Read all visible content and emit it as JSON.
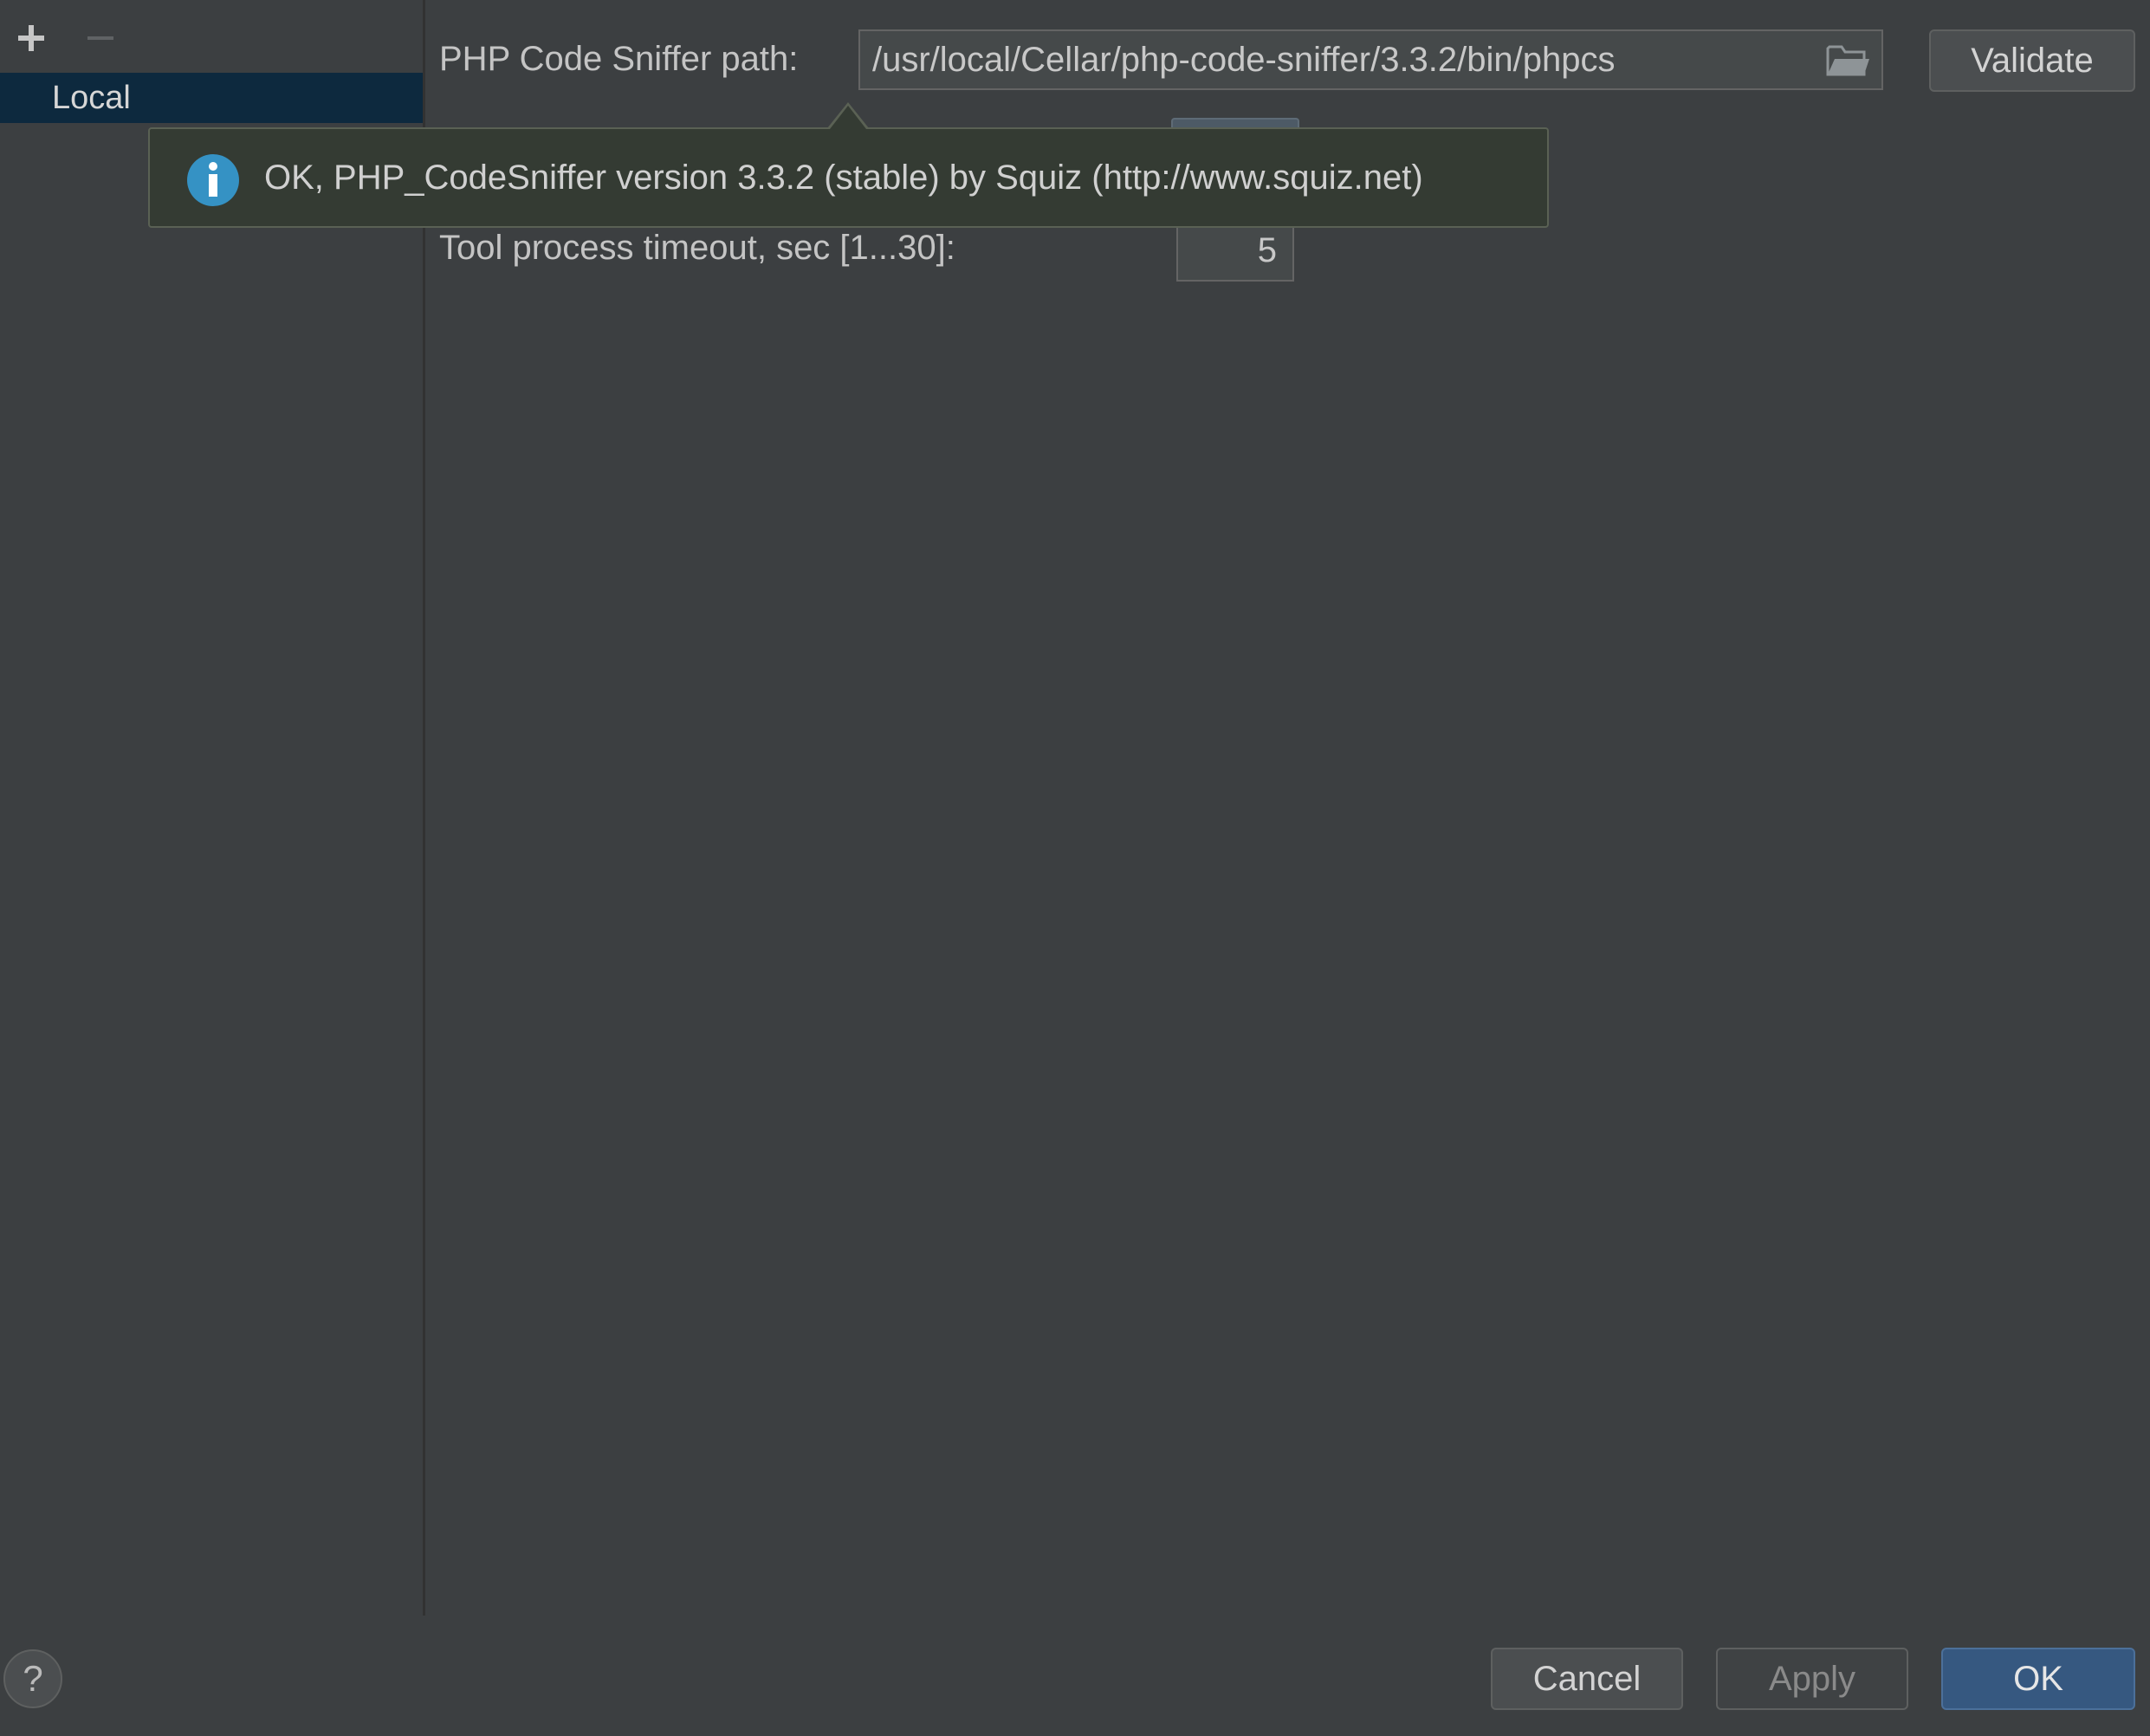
{
  "sidebar": {
    "toolbar": {
      "add_icon": "plus-icon",
      "remove_icon": "minus-icon"
    },
    "items": [
      {
        "label": "Local",
        "selected": true
      }
    ]
  },
  "form": {
    "path_label": "PHP Code Sniffer path:",
    "path_value": "/usr/local/Cellar/php-code-sniffer/3.3.2/bin/phpcs",
    "browse_icon": "folder-icon",
    "validate_label": "Validate",
    "timeout_label": "Tool process timeout, sec [1...30]:",
    "timeout_value": "5"
  },
  "tooltip": {
    "icon": "info-icon",
    "message": "OK, PHP_CodeSniffer version 3.3.2 (stable) by Squiz (http://www.squiz.net)"
  },
  "footer": {
    "help_label": "?",
    "cancel_label": "Cancel",
    "apply_label": "Apply",
    "ok_label": "OK"
  },
  "colors": {
    "background": "#3c3f41",
    "selection": "#0d293e",
    "primary_button": "#365880",
    "info_blue": "#3592c4",
    "tooltip_bg": "#343b33"
  }
}
